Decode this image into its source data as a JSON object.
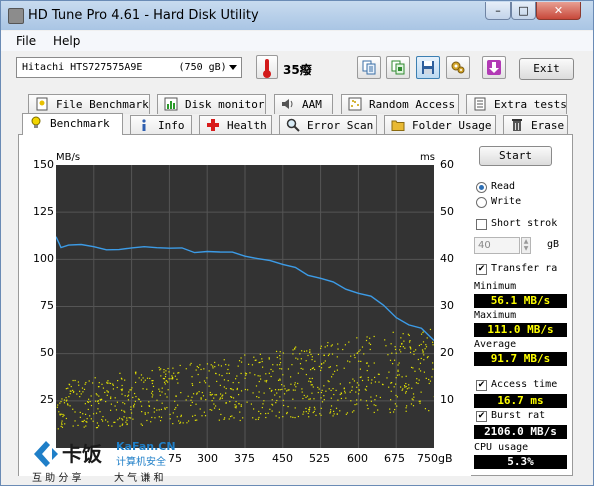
{
  "window": {
    "title": "HD Tune Pro 4.61 - Hard Disk Utility"
  },
  "menu": {
    "file": "File",
    "help": "Help"
  },
  "toolbar": {
    "drive": "Hitachi HTS727575A9E      (750 gB)",
    "temperature": "35癈",
    "exit_label": "Exit"
  },
  "tabs_top": [
    "File Benchmark",
    "Disk monitor",
    "AAM",
    "Random Access",
    "Extra tests"
  ],
  "tabs_bottom": [
    "Benchmark",
    "Info",
    "Health",
    "Error Scan",
    "Folder Usage",
    "Erase"
  ],
  "chart_data": {
    "type": "line",
    "ylabel_left": "MB/s",
    "ylabel_right": "ms",
    "yticks_left": [
      "150",
      "125",
      "100",
      "75",
      "50",
      "25"
    ],
    "yticks_right": [
      "60",
      "50",
      "40",
      "30",
      "20",
      "10"
    ],
    "xticks": [
      "75",
      "300",
      "375",
      "450",
      "525",
      "600",
      "675",
      "750gB"
    ],
    "xlim": [
      0,
      750
    ],
    "ylim_left": [
      0,
      150
    ],
    "ylim_right": [
      0,
      60
    ],
    "series": [
      {
        "name": "Read",
        "color": "#3c9be6",
        "x": [
          0,
          10,
          25,
          50,
          75,
          100,
          125,
          150,
          175,
          200,
          225,
          250,
          275,
          300,
          325,
          350,
          375,
          400,
          425,
          450,
          475,
          500,
          525,
          550,
          575,
          600,
          625,
          650,
          675,
          700,
          725,
          750
        ],
        "values": [
          112,
          106,
          108,
          107,
          106,
          106,
          106,
          106,
          106,
          106,
          106,
          106,
          104,
          104,
          103,
          103,
          101,
          101,
          99,
          97,
          95,
          92,
          90,
          88,
          84,
          82,
          80,
          75,
          70,
          66,
          63,
          57
        ]
      },
      {
        "name": "Access time",
        "color": "#e6e600",
        "type": "scatter",
        "band_x": [
          0,
          750
        ],
        "band_low_ms": [
          4,
          8
        ],
        "band_high_ms": [
          14,
          26
        ]
      }
    ]
  },
  "sidebar": {
    "start": "Start",
    "read": "Read",
    "write": "Write",
    "short_stroke": "Short strok",
    "short_stroke_value": "40",
    "short_stroke_unit": "gB",
    "transfer_rate": "Transfer ra",
    "minimum_label": "Minimum",
    "minimum_value": "56.1 MB/s",
    "maximum_label": "Maximum",
    "maximum_value": "111.0 MB/s",
    "average_label": "Average",
    "average_value": "91.7 MB/s",
    "access_time": "Access time",
    "access_time_value": "16.7 ms",
    "burst_rate": "Burst rat",
    "burst_rate_value": "2106.0 MB/s",
    "cpu_usage": "CPU usage",
    "cpu_usage_value": "5.3%"
  },
  "watermark": {
    "brand": "卡饭",
    "site": "KaFan.CN",
    "cn1": "计算机安全",
    "cn2": "互 助 分 享",
    "cn3": "大 气 谦 和"
  }
}
